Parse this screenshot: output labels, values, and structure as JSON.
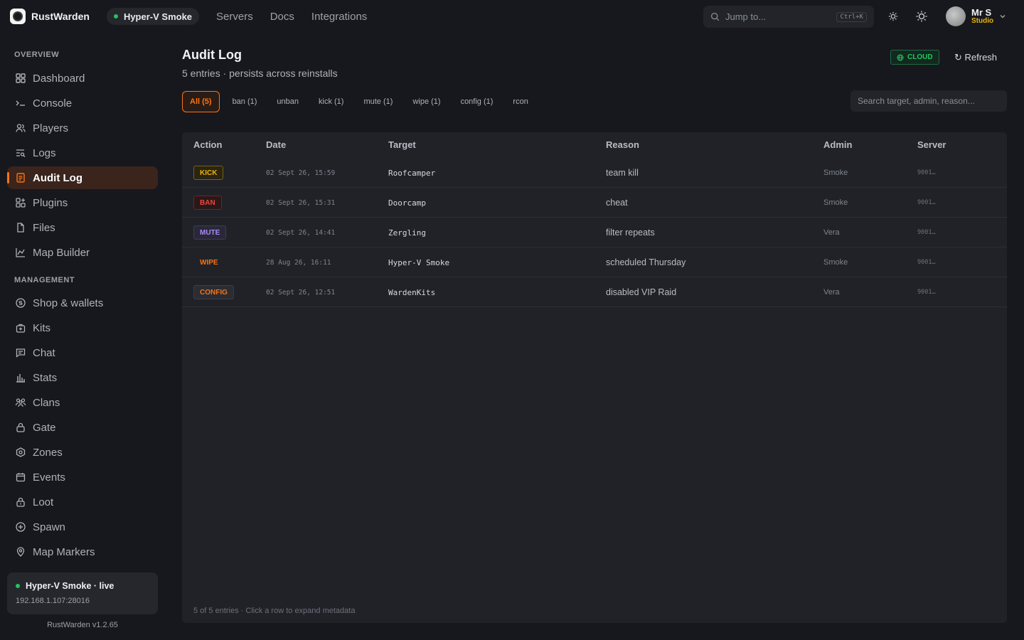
{
  "brand": {
    "name": "RustWarden"
  },
  "server_chip": {
    "label": "Hyper-V Smoke"
  },
  "topnav": [
    "Servers",
    "Docs",
    "Integrations"
  ],
  "jump": {
    "placeholder": "Jump to...",
    "shortcut": "Ctrl+K"
  },
  "user": {
    "name": "Mr S",
    "role": "Studio"
  },
  "sidebar": {
    "overview_label": "OVERVIEW",
    "overview": [
      {
        "label": "Dashboard",
        "icon": "grid-icon"
      },
      {
        "label": "Console",
        "icon": "terminal-icon"
      },
      {
        "label": "Players",
        "icon": "users-icon"
      },
      {
        "label": "Logs",
        "icon": "list-search-icon"
      },
      {
        "label": "Audit Log",
        "icon": "document-icon"
      },
      {
        "label": "Plugins",
        "icon": "plugin-grid-icon"
      },
      {
        "label": "Files",
        "icon": "file-icon"
      },
      {
        "label": "Map Builder",
        "icon": "map-chart-icon"
      }
    ],
    "management_label": "MANAGEMENT",
    "management": [
      {
        "label": "Shop & wallets",
        "icon": "coin-icon"
      },
      {
        "label": "Kits",
        "icon": "kit-bag-icon"
      },
      {
        "label": "Chat",
        "icon": "chat-icon"
      },
      {
        "label": "Stats",
        "icon": "bar-chart-icon"
      },
      {
        "label": "Clans",
        "icon": "group-icon"
      },
      {
        "label": "Gate",
        "icon": "lock-icon"
      },
      {
        "label": "Zones",
        "icon": "hexagon-icon"
      },
      {
        "label": "Events",
        "icon": "calendar-icon"
      },
      {
        "label": "Loot",
        "icon": "loot-lock-icon"
      },
      {
        "label": "Spawn",
        "icon": "plus-circle-icon"
      },
      {
        "label": "Map Markers",
        "icon": "pin-icon"
      }
    ],
    "status": {
      "title": "Hyper-V Smoke · live",
      "ip": "192.168.1.107:28016"
    },
    "version": "RustWarden v1.2.65"
  },
  "page": {
    "title": "Audit Log",
    "subtitle": "5 entries · persists across reinstalls",
    "cloud_badge": "CLOUD",
    "refresh_label": "↻ Refresh",
    "search_placeholder": "Search target, admin, reason..."
  },
  "filters": [
    {
      "label": "All (5)",
      "active": true
    },
    {
      "label": "ban (1)"
    },
    {
      "label": "unban"
    },
    {
      "label": "kick (1)"
    },
    {
      "label": "mute (1)"
    },
    {
      "label": "wipe (1)"
    },
    {
      "label": "config (1)"
    },
    {
      "label": "rcon"
    }
  ],
  "table": {
    "columns": [
      "Action",
      "Date",
      "Target",
      "Reason",
      "Admin",
      "Server"
    ],
    "rows": [
      {
        "action": "KICK",
        "kind": "kick",
        "date": "02 Sept 26, 15:59",
        "target": "Roofcamper",
        "reason": "team kill",
        "admin": "Smoke",
        "server": "9001…"
      },
      {
        "action": "BAN",
        "kind": "ban",
        "date": "02 Sept 26, 15:31",
        "target": "Doorcamp",
        "reason": "cheat",
        "admin": "Smoke",
        "server": "9001…"
      },
      {
        "action": "MUTE",
        "kind": "mute",
        "date": "02 Sept 26, 14:41",
        "target": "Zergling",
        "reason": "filter repeats",
        "admin": "Vera",
        "server": "9001…"
      },
      {
        "action": "WIPE",
        "kind": "wipe",
        "date": "28 Aug 26, 16:11",
        "target": "Hyper-V Smoke",
        "reason": "scheduled Thursday",
        "admin": "Smoke",
        "server": "9001…"
      },
      {
        "action": "CONFIG",
        "kind": "config",
        "date": "02 Sept 26, 12:51",
        "target": "WardenKits",
        "reason": "disabled VIP Raid",
        "admin": "Vera",
        "server": "9001…"
      }
    ],
    "footer": "5 of 5 entries · Click a row to expand metadata"
  },
  "colors": {
    "accent": "#f97316",
    "live": "#22c55e",
    "role": "#eab308"
  }
}
